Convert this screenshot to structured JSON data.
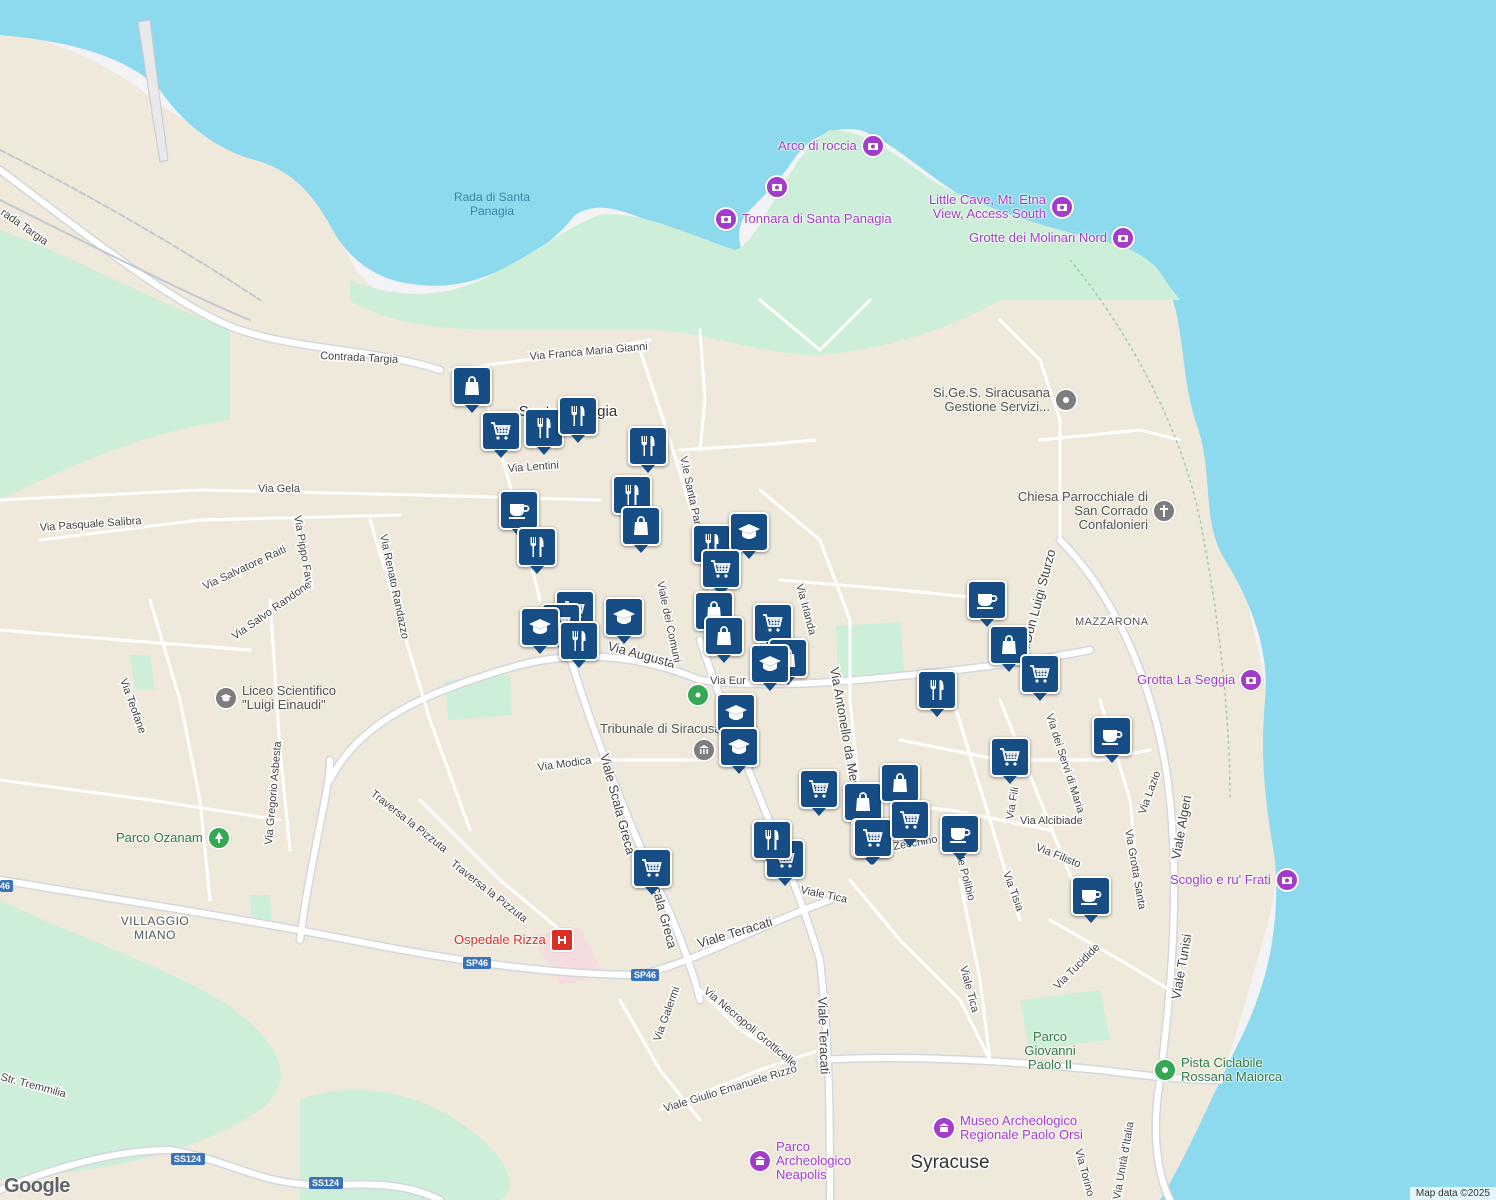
{
  "map": {
    "colors": {
      "water": "#8dd9ee",
      "land": "#f3f3f5",
      "park": "#cdeed8",
      "sand": "#efe9dc",
      "road": "#ffffff",
      "road_outline": "#d3d7de",
      "marker": "#174d85",
      "poi_attraction": "#a13dc9"
    },
    "water_labels": [
      "Rada di Santa",
      "Panagia"
    ],
    "area_labels": {
      "city": "Syracuse",
      "santa_panagia": "Santa Panagia",
      "mazzarona": "MAZZARONA",
      "villaggio_1": "VILLAGGIO",
      "villaggio_2": "MIANO"
    },
    "street_labels": {
      "contrada_targia": "Contrada Targia",
      "contrada_targia_w": "rada Targia",
      "via_franca": "Via Franca Maria Gianni",
      "via_lentini": "Via Lentini",
      "via_gela": "Via Gela",
      "via_pasquale": "Via Pasquale Salibra",
      "via_salvatore": "Via Salvatore Raiti",
      "via_pippo": "Via Pippo Fava",
      "via_salvo": "Via Salvo Randone",
      "via_renato": "Via Renato Randazzo",
      "via_teofane": "Via Teofane",
      "via_gregorio": "Via Gregorio Asbesta",
      "via_augusta": "Via Augusta",
      "via_modica": "Via Modica",
      "viale_scala_greca": "Viale Scala Greca",
      "scala_greca": "Scala Greca",
      "viale_dei_comuni": "Viale dei Comuni",
      "vle_santa_panagia": "V.le Santa Panag",
      "via_irlanda": "Via Irlanda",
      "via_antonello": "Via Antonello da Messina",
      "via_don_luigi": "Via Don Luigi Sturzo",
      "via_servi": "Via dei Servi di Maria",
      "via_lazio": "Via Lazio",
      "via_grotta_santa": "Via Grotta Santa",
      "viale_algeri": "Viale Algeri",
      "viale_tunisi": "Viale Tunisi",
      "via_alcibiade": "Via Alcibiade",
      "via_filisto": "Via Filisto",
      "via_tisia": "Via Tisia",
      "via_tucidide": "Via Tucidide",
      "viale_polibio": "Viale Polibio",
      "viale_tica": "Viale Tica",
      "viale_tica2": "Viale Tica",
      "viale_teracati": "Viale Teracati",
      "viale_teracati2": "Viale Teracati",
      "via_necropoli": "Via Necropoli Grotticelle",
      "via_galermi": "Via Galermi",
      "viale_giulio": "Viale Giulio Emanuele Rizzo",
      "traversa1": "Traversa la Pizzuta",
      "traversa2": "Traversa la Pizzuta",
      "str_tremmilia": "Str. Tremmilia",
      "via_unita": "Via Unità d'Italia",
      "via_torino": "Via Torino",
      "via_zecchino": "Zecchino",
      "via_europa": "Via Eur",
      "via_filisto2": "Via Fili",
      "sp46a": "SP46",
      "sp46b": "SP46",
      "sp46c": "SP46",
      "ss124a": "SS124",
      "ss124b": "SS124"
    },
    "pois": [
      {
        "id": "arco",
        "label": "Arco di roccia",
        "type": "attraction"
      },
      {
        "id": "tonnara",
        "label": "Tonnara di Santa Panagia",
        "type": "attraction"
      },
      {
        "id": "cave_icon",
        "label": "",
        "type": "attraction"
      },
      {
        "id": "little_cave",
        "label": "Little Cave, Mt. Etna View, Access South",
        "type": "attraction"
      },
      {
        "id": "grotte",
        "label": "Grotte dei Molinari Nord",
        "type": "attraction"
      },
      {
        "id": "sigesi",
        "label": "Si.Ge.S. Siracusana Gestione Servizi...",
        "type": "business"
      },
      {
        "id": "chiesa",
        "label": "Chiesa Parrocchiale di San Corrado Confalonieri",
        "type": "church"
      },
      {
        "id": "grotta_seggia",
        "label": "Grotta La Seggia",
        "type": "attraction"
      },
      {
        "id": "scoglio",
        "label": "Scoglio e ru' Frati",
        "type": "attraction"
      },
      {
        "id": "liceo",
        "label": "Liceo Scientifico \"Luigi Einaudi\"",
        "type": "school"
      },
      {
        "id": "parco_ozanam",
        "label": "Parco Ozanam",
        "type": "park"
      },
      {
        "id": "tribunale",
        "label": "Tribunale di Siracusa",
        "type": "government"
      },
      {
        "id": "ospedale",
        "label": "Ospedale Rizza",
        "type": "hospital"
      },
      {
        "id": "parco_giovanni",
        "label": "Parco Giovanni Paolo II",
        "type": "park_label"
      },
      {
        "id": "pista",
        "label": "Pista Ciclabile Rossana Maiorca",
        "type": "park"
      },
      {
        "id": "museo",
        "label": "Museo Archeologico Regionale Paolo Orsi",
        "type": "attraction"
      },
      {
        "id": "neapolis",
        "label": "Parco Archeologico Neapolis",
        "type": "attraction"
      },
      {
        "id": "green_dot",
        "label": "",
        "type": "park"
      }
    ],
    "markers": [
      {
        "icon": "bag-icon"
      },
      {
        "icon": "cart-icon"
      },
      {
        "icon": "fork-knife-icon"
      },
      {
        "icon": "fork-knife-icon"
      },
      {
        "icon": "fork-knife-icon"
      },
      {
        "icon": "fork-knife-icon"
      },
      {
        "icon": "bag-icon"
      },
      {
        "icon": "cup-icon"
      },
      {
        "icon": "fork-knife-icon"
      },
      {
        "icon": "fork-knife-icon"
      },
      {
        "icon": "graduation-icon"
      },
      {
        "icon": "cart-icon"
      },
      {
        "icon": "cart-icon"
      },
      {
        "icon": "cart-icon"
      },
      {
        "icon": "graduation-icon"
      },
      {
        "icon": "graduation-icon"
      },
      {
        "icon": "fork-knife-icon"
      },
      {
        "icon": "bag-icon"
      },
      {
        "icon": "bag-icon"
      },
      {
        "icon": "cart-icon"
      },
      {
        "icon": "bag-icon"
      },
      {
        "icon": "graduation-icon"
      },
      {
        "icon": "graduation-icon"
      },
      {
        "icon": "graduation-icon"
      },
      {
        "icon": "cup-icon"
      },
      {
        "icon": "bag-icon"
      },
      {
        "icon": "cart-icon"
      },
      {
        "icon": "fork-knife-icon"
      },
      {
        "icon": "cup-icon"
      },
      {
        "icon": "cart-icon"
      },
      {
        "icon": "cart-icon"
      },
      {
        "icon": "bag-icon"
      },
      {
        "icon": "cart-icon"
      },
      {
        "icon": "bag-icon"
      },
      {
        "icon": "cart-icon"
      },
      {
        "icon": "cup-icon"
      },
      {
        "icon": "fork-knife-icon"
      },
      {
        "icon": "cart-icon"
      },
      {
        "icon": "cart-icon"
      },
      {
        "icon": "cart-icon"
      },
      {
        "icon": "cup-icon"
      }
    ],
    "attribution": "Map data ©2025",
    "logo": "Google"
  }
}
